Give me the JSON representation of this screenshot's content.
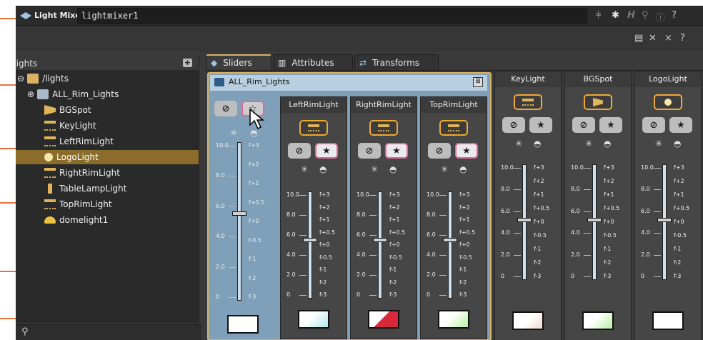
{
  "window": {
    "app_name": "Light Mixer",
    "node_path": "lightmixer1",
    "accent": "#d8b262",
    "callout_color": "#e8733a"
  },
  "sidebar": {
    "label": "Lights",
    "items": [
      {
        "label": "/lights",
        "icon": "folder-icon",
        "level": 0
      },
      {
        "label": "ALL_Rim_Lights",
        "icon": "group-icon",
        "level": 1
      },
      {
        "label": "BGSpot",
        "icon": "spotlight-icon",
        "level": 2
      },
      {
        "label": "KeyLight",
        "icon": "arealight-icon",
        "level": 2
      },
      {
        "label": "LeftRimLight",
        "icon": "arealight-icon",
        "level": 2
      },
      {
        "label": "LogoLight",
        "icon": "pointlight-icon",
        "level": 2,
        "selected": true
      },
      {
        "label": "RightRimLight",
        "icon": "arealight-icon",
        "level": 2
      },
      {
        "label": "TableLampLight",
        "icon": "lamp-icon",
        "level": 2
      },
      {
        "label": "TopRimLight",
        "icon": "arealight-icon",
        "level": 2
      },
      {
        "label": "domelight1",
        "icon": "domelight-icon",
        "level": 2
      }
    ]
  },
  "tabs": [
    {
      "label": "Sliders",
      "active": true
    },
    {
      "label": "Attributes"
    },
    {
      "label": "Transforms"
    }
  ],
  "group": {
    "name": "ALL_Rim_Lights"
  },
  "scale": {
    "left": [
      "10.0",
      "8.0",
      "6.0",
      "4.0",
      "2.0",
      "0"
    ],
    "right": [
      "f+3",
      "f+2",
      "f+1",
      "f+0.5",
      "f+0",
      "f-0.5",
      "f-1",
      "f-2",
      "f-3"
    ]
  },
  "channels": [
    {
      "name": "LeftRimLight",
      "level": 0.55
    },
    {
      "name": "RightRimLight",
      "level": 0.55
    },
    {
      "name": "TopRimLight",
      "level": 0.55
    },
    {
      "name": "KeyLight",
      "level": 0.52
    },
    {
      "name": "BGSpot",
      "level": 0.52
    },
    {
      "name": "LogoLight",
      "level": 0.52
    }
  ],
  "group_level": 0.55
}
